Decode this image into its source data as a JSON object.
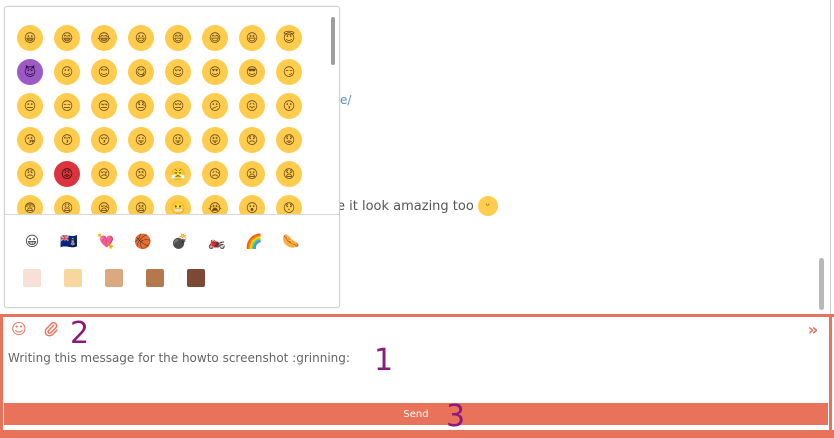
{
  "history": {
    "link_fragment": "e/",
    "message_fragment": "e it look amazing too"
  },
  "emoji_picker": {
    "rows": [
      [
        "😀",
        "😁",
        "😂",
        "😃",
        "😄",
        "😅",
        "😆",
        "😇"
      ],
      [
        "😈",
        "😉",
        "😊",
        "😋",
        "😌",
        "😍",
        "😎",
        "😏"
      ],
      [
        "😐",
        "😑",
        "😒",
        "😓",
        "😔",
        "😕",
        "😖",
        "😗"
      ],
      [
        "😘",
        "😙",
        "😚",
        "😛",
        "😜",
        "😝",
        "😞",
        "😟"
      ],
      [
        "😠",
        "😡",
        "😢",
        "😣",
        "😤",
        "😥",
        "😦",
        "😧"
      ],
      [
        "😨",
        "😩",
        "😪",
        "😫",
        "😬",
        "😭",
        "😮",
        "😯"
      ]
    ],
    "categories": [
      "😀",
      "🇰🇾",
      "💘",
      "🏀",
      "💣",
      "🏍️",
      "🌈",
      "🌭"
    ],
    "skin_tones": [
      "#f8e0d6",
      "#f7d79e",
      "#dba97f",
      "#b4784a",
      "#7c4a34"
    ]
  },
  "toolbar": {
    "emoji_icon": "smiley-icon",
    "attach_icon": "paperclip-icon",
    "expand_icon": "double-chevron-right-icon"
  },
  "compose": {
    "text": "Writing this message for the howto screenshot :grinning:"
  },
  "send": {
    "label": "Send"
  },
  "callouts": {
    "one": "1",
    "two": "2",
    "three": "3"
  }
}
